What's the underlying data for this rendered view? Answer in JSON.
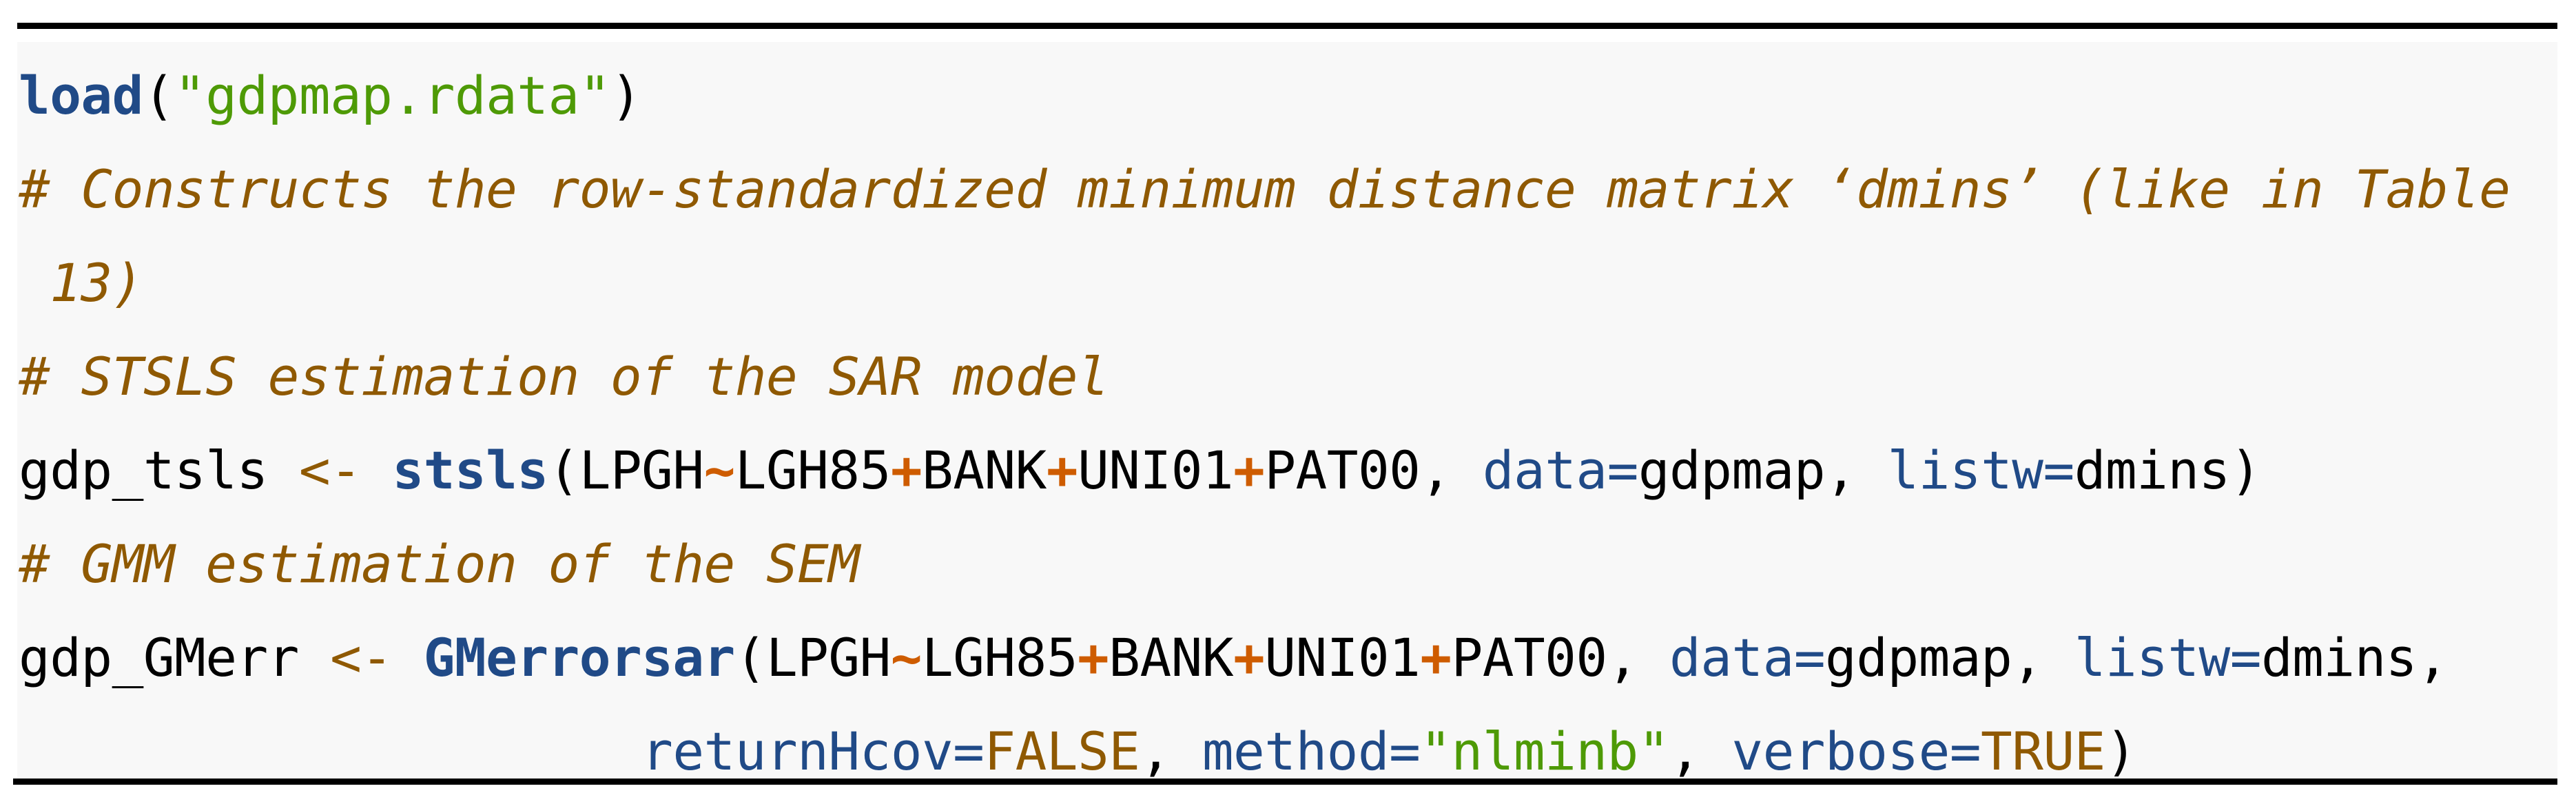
{
  "code": {
    "language": "r",
    "lines": [
      {
        "tokens": [
          {
            "type": "kw",
            "text": "load"
          },
          {
            "type": "plain",
            "text": "("
          },
          {
            "type": "str",
            "text": "\"gdpmap.rdata\""
          },
          {
            "type": "plain",
            "text": ")"
          }
        ]
      },
      {
        "tokens": [
          {
            "type": "cm",
            "text": "# Constructs the row-standardized minimum distance matrix ‘dmins’ (like in Table"
          }
        ]
      },
      {
        "tokens": [
          {
            "type": "cm",
            "text": " 13)"
          }
        ]
      },
      {
        "tokens": [
          {
            "type": "cm",
            "text": "# STSLS estimation of the SAR model"
          }
        ]
      },
      {
        "tokens": [
          {
            "type": "plain",
            "text": "gdp_tsls "
          },
          {
            "type": "assign",
            "text": "<-"
          },
          {
            "type": "plain",
            "text": " "
          },
          {
            "type": "kw",
            "text": "stsls"
          },
          {
            "type": "plain",
            "text": "(LPGH"
          },
          {
            "type": "op",
            "text": "~"
          },
          {
            "type": "plain",
            "text": "LGH85"
          },
          {
            "type": "op",
            "text": "+"
          },
          {
            "type": "plain",
            "text": "BANK"
          },
          {
            "type": "op",
            "text": "+"
          },
          {
            "type": "plain",
            "text": "UNI01"
          },
          {
            "type": "op",
            "text": "+"
          },
          {
            "type": "plain",
            "text": "PAT00, "
          },
          {
            "type": "arg",
            "text": "data="
          },
          {
            "type": "plain",
            "text": "gdpmap, "
          },
          {
            "type": "arg",
            "text": "listw="
          },
          {
            "type": "plain",
            "text": "dmins)"
          }
        ]
      },
      {
        "tokens": [
          {
            "type": "cm",
            "text": "# GMM estimation of the SEM"
          }
        ]
      },
      {
        "tokens": [
          {
            "type": "plain",
            "text": "gdp_GMerr "
          },
          {
            "type": "assign",
            "text": "<-"
          },
          {
            "type": "plain",
            "text": " "
          },
          {
            "type": "kw",
            "text": "GMerrorsar"
          },
          {
            "type": "plain",
            "text": "(LPGH"
          },
          {
            "type": "op",
            "text": "~"
          },
          {
            "type": "plain",
            "text": "LGH85"
          },
          {
            "type": "op",
            "text": "+"
          },
          {
            "type": "plain",
            "text": "BANK"
          },
          {
            "type": "op",
            "text": "+"
          },
          {
            "type": "plain",
            "text": "UNI01"
          },
          {
            "type": "op",
            "text": "+"
          },
          {
            "type": "plain",
            "text": "PAT00, "
          },
          {
            "type": "arg",
            "text": "data="
          },
          {
            "type": "plain",
            "text": "gdpmap, "
          },
          {
            "type": "arg",
            "text": "listw="
          },
          {
            "type": "plain",
            "text": "dmins,"
          }
        ]
      },
      {
        "tokens": [
          {
            "type": "plain",
            "text": "                    "
          },
          {
            "type": "arg",
            "text": "returnHcov="
          },
          {
            "type": "const",
            "text": "FALSE"
          },
          {
            "type": "plain",
            "text": ", "
          },
          {
            "type": "arg",
            "text": "method="
          },
          {
            "type": "str",
            "text": "\"nlminb\""
          },
          {
            "type": "plain",
            "text": ", "
          },
          {
            "type": "arg",
            "text": "verbose="
          },
          {
            "type": "const",
            "text": "TRUE"
          },
          {
            "type": "plain",
            "text": ")"
          }
        ]
      }
    ]
  },
  "colors": {
    "keyword": "#204a87",
    "string": "#4e9a06",
    "comment": "#8f5902",
    "operator": "#ce5c00",
    "assignment": "#8f5902",
    "argument": "#204a87",
    "constant": "#8f5902",
    "background": "#f8f8f8",
    "rule": "#000000"
  }
}
